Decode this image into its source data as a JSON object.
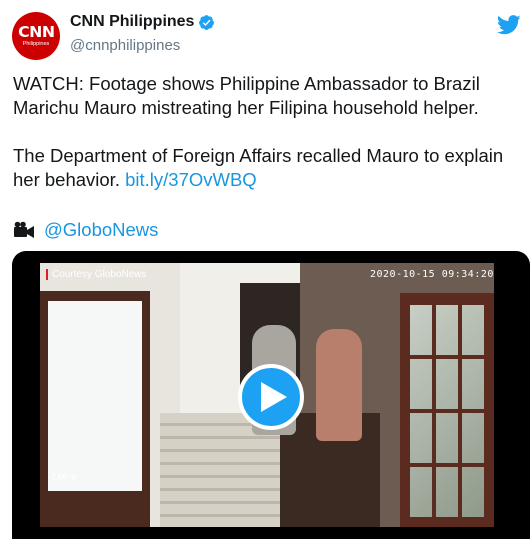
{
  "tweet": {
    "author": {
      "display_name": "CNN Philippines",
      "handle": "@cnnphilippines",
      "avatar_text": "CNN",
      "avatar_subtext": "Philippines",
      "verified": true
    },
    "text_paragraph_1": "WATCH: Footage shows Philippine Ambassador to Brazil\nMarichu Mauro mistreating her Filipina household helper.",
    "text_paragraph_2_prefix": "The Department of Foreign Affairs recalled Mauro to explain\nher behavior. ",
    "link_text": "bit.ly/37OvWBQ",
    "attribution_label": "@GloboNews",
    "icons": {
      "verified": "verified-badge-icon",
      "twitter": "twitter-bird-icon",
      "camera": "video-camera-icon",
      "play": "play-icon"
    }
  },
  "video": {
    "overlay_courtesy": "Courtesy GloboNews",
    "overlay_timestamp": "2020-10-15 09:34:20",
    "overlay_cam": "CAM 9"
  },
  "colors": {
    "accent": "#1da1f2",
    "link": "#1b95e0",
    "brand_red": "#cc0000",
    "secondary_text": "#657786"
  }
}
